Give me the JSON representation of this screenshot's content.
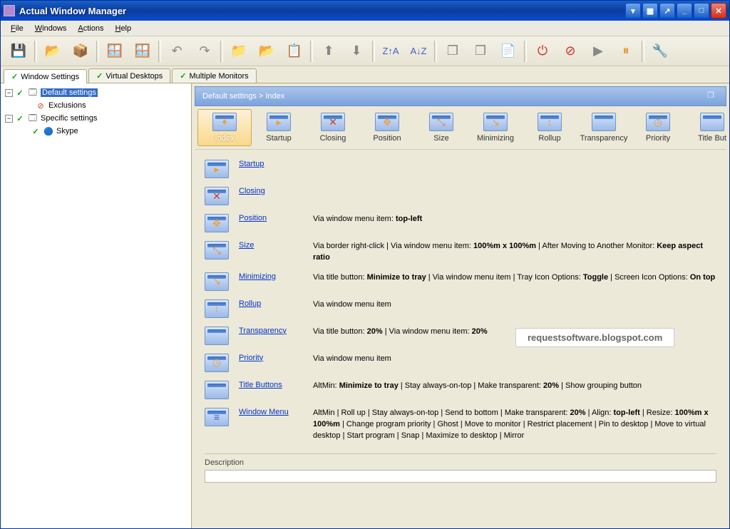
{
  "window": {
    "title": "Actual Window Manager"
  },
  "menu": {
    "file": "File",
    "windows": "Windows",
    "actions": "Actions",
    "help": "Help"
  },
  "tabs": {
    "t1": "Window Settings",
    "t2": "Virtual Desktops",
    "t3": "Multiple Monitors"
  },
  "tree": {
    "default": "Default settings",
    "exclusions": "Exclusions",
    "specific": "Specific settings",
    "skype": "Skype"
  },
  "breadcrumb": "Default settings > Index",
  "nav": {
    "index": "Index",
    "startup": "Startup",
    "closing": "Closing",
    "position": "Position",
    "size": "Size",
    "minimizing": "Minimizing",
    "rollup": "Rollup",
    "transparency": "Transparency",
    "priority": "Priority",
    "titlebut": "Title But"
  },
  "rows": {
    "startup": {
      "label": "Startup",
      "desc": ""
    },
    "closing": {
      "label": "Closing",
      "desc": ""
    },
    "position": {
      "label": "Position",
      "desc": "Via window menu item: <b>top-left</b>"
    },
    "size": {
      "label": "Size",
      "desc": "Via border right-click | Via window menu item: <b>100%m x 100%m</b> | After Moving to Another Monitor: <b>Keep aspect ratio</b>"
    },
    "minimizing": {
      "label": "Minimizing",
      "desc": "Via title button: <b>Minimize to tray</b> | Via window menu item | Tray Icon Options: <b>Toggle</b> | Screen Icon Options: <b>On top</b>"
    },
    "rollup": {
      "label": "Rollup",
      "desc": "Via window menu item"
    },
    "transparency": {
      "label": "Transparency",
      "desc": "Via title button: <b>20%</b> | Via window menu item: <b>20%</b>"
    },
    "priority": {
      "label": "Priority",
      "desc": "Via window menu item"
    },
    "titlebuttons": {
      "label": "Title Buttons",
      "desc": "AltMin: <b>Minimize to tray</b> | Stay always-on-top | Make transparent: <b>20%</b> | Show grouping button"
    },
    "windowmenu": {
      "label": "Window Menu",
      "desc": "AltMin | Roll up | Stay always-on-top | Send to bottom | Make transparent: <b>20%</b> | Align: <b>top-left</b> | Resize: <b>100%m x 100%m</b> | Change program priority | Ghost | Move to monitor | Restrict placement | Pin to desktop | Move to virtual desktop | Start program | Snap | Maximize to desktop | Mirror"
    }
  },
  "description_label": "Description",
  "watermark": "requestsoftware.blogspot.com"
}
